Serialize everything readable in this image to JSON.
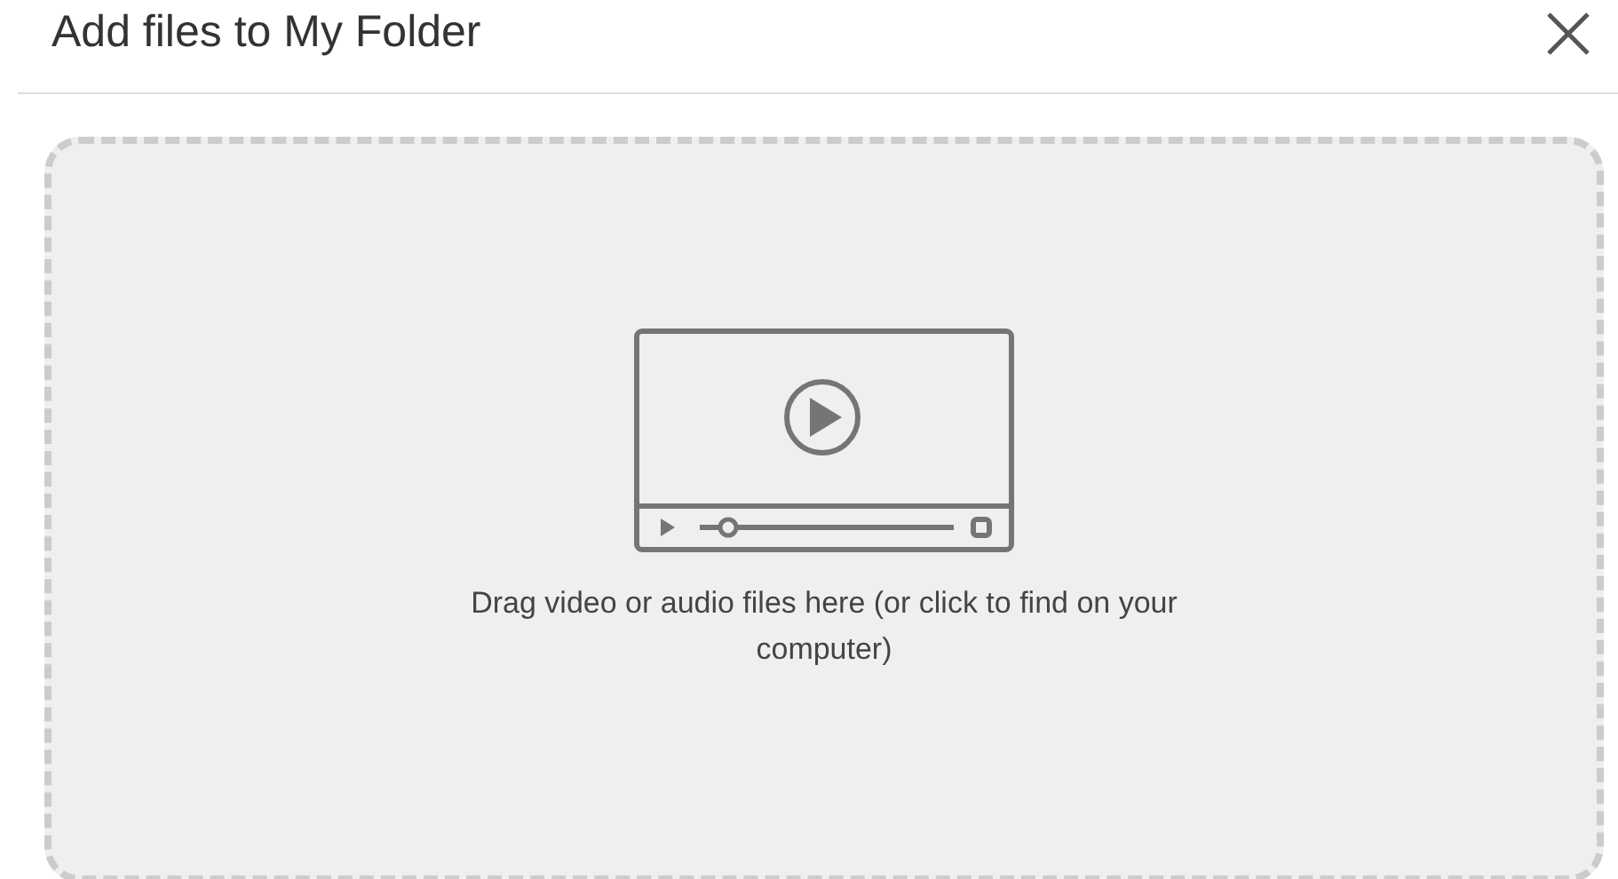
{
  "dialog": {
    "title": "Add files to My Folder"
  },
  "drop_zone": {
    "text": "Drag video or audio files here (or click to find on your computer)"
  }
}
